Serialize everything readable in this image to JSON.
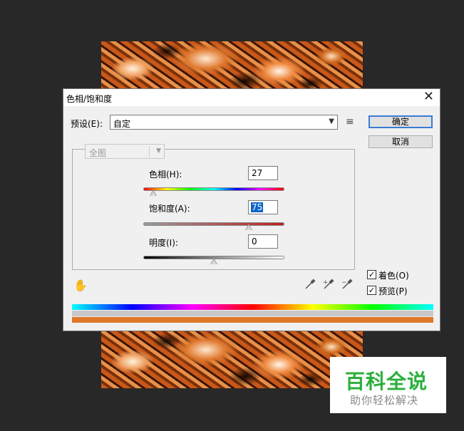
{
  "dialog": {
    "title": "色相/饱和度",
    "close_glyph": "✕",
    "preset_label": "预设(E):",
    "preset_value": "自定",
    "ok_label": "确定",
    "cancel_label": "取消",
    "channel_value": "全图",
    "hue_label": "色相(H):",
    "hue_value": "27",
    "saturation_label": "饱和度(A):",
    "saturation_value": "75",
    "lightness_label": "明度(I):",
    "lightness_value": "0",
    "colorize_label": "着色(O)",
    "colorize_checked": true,
    "preview_label": "预览(P)",
    "preview_checked": true,
    "icons": [
      "menu-icon",
      "hand-tool-icon",
      "eyedropper-icon",
      "eyedropper-plus-icon",
      "eyedropper-minus-icon",
      "close-icon",
      "chevron-down-icon"
    ],
    "colors": {
      "colorize_bar": "#e0782a",
      "accent": "#0a64c8"
    }
  },
  "watermark": {
    "main": "百科全说",
    "sub": "助你轻松解决"
  }
}
